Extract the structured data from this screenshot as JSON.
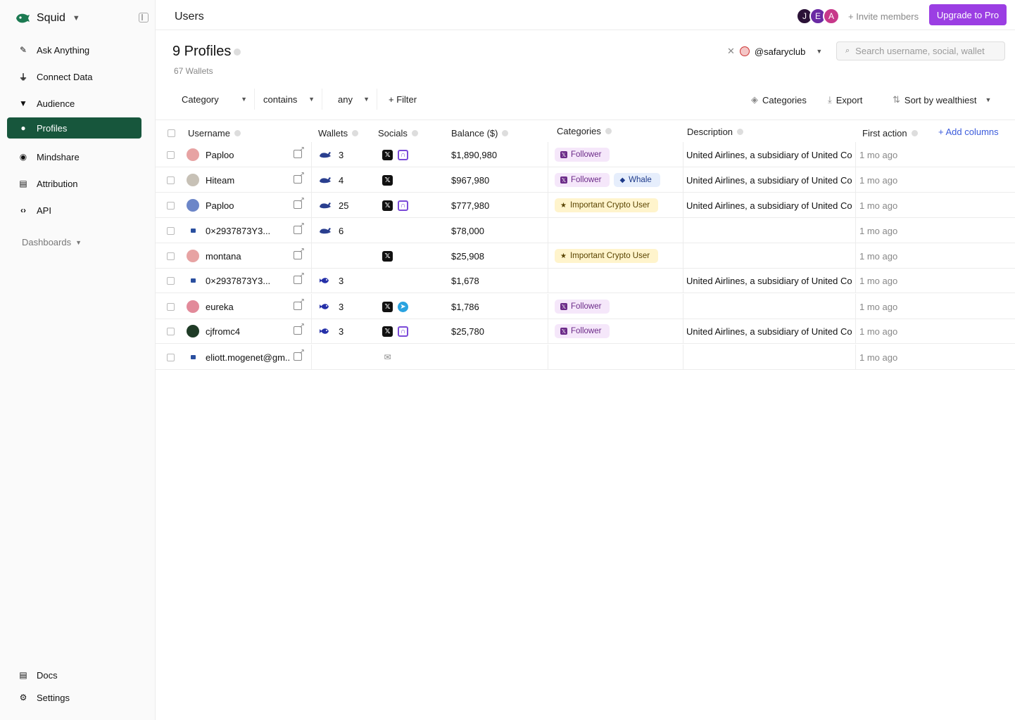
{
  "sidebar": {
    "brand": "Squid",
    "items": [
      {
        "label": "Ask Anything",
        "icon": "magic-wand-icon"
      },
      {
        "label": "Connect Data",
        "icon": "plug-icon"
      },
      {
        "label": "Audience",
        "icon": "funnel-icon"
      },
      {
        "label": "Profiles",
        "icon": "user-icon",
        "active": true
      },
      {
        "label": "Mindshare",
        "icon": "compass-icon"
      },
      {
        "label": "Attribution",
        "icon": "document-icon"
      },
      {
        "label": "API",
        "icon": "code-icon"
      }
    ],
    "section": "Dashboards",
    "footer": [
      {
        "label": "Docs",
        "icon": "book-icon"
      },
      {
        "label": "Settings",
        "icon": "gear-icon"
      }
    ]
  },
  "topbar": {
    "title": "Users",
    "avatars": [
      {
        "letter": "J",
        "color": "#2b1237"
      },
      {
        "letter": "E",
        "color": "#6a2aa3"
      },
      {
        "letter": "A",
        "color": "#c7388a"
      }
    ],
    "invite": "+ Invite members",
    "upgrade": "Upgrade to Pro"
  },
  "header": {
    "title": "9 Profiles",
    "subtitle": "67 Wallets",
    "account": "@safaryclub",
    "search_placeholder": "Search username, social, wallet"
  },
  "filters": {
    "category": "Category",
    "operator": "contains",
    "value": "any",
    "add": "+ Filter",
    "categories": "Categories",
    "export": "Export",
    "sort": "Sort by wealthiest"
  },
  "table": {
    "columns": {
      "username": "Username",
      "wallets": "Wallets",
      "socials": "Socials",
      "balance": "Balance ($)",
      "categories": "Categories",
      "description": "Description",
      "first_action": "First action",
      "add_columns": "+ Add columns"
    },
    "rows": [
      {
        "username": "Paploo",
        "avatar": "#e7a3a3",
        "wallet_icon": "whale",
        "wallets": "3",
        "socials": [
          "x",
          "farcaster"
        ],
        "balance": "$1,890,980",
        "tags": [
          {
            "label": "Follower",
            "type": "follower"
          }
        ],
        "description": "United Airlines, a subsidiary of United Co",
        "ago": "1 mo ago"
      },
      {
        "username": "Hiteam",
        "avatar": "#c7c1b6",
        "wallet_icon": "whale",
        "wallets": "4",
        "socials": [
          "x"
        ],
        "balance": "$967,980",
        "tags": [
          {
            "label": "Follower",
            "type": "follower"
          },
          {
            "label": "Whale",
            "type": "whale"
          }
        ],
        "description": "United Airlines, a subsidiary of United Co",
        "ago": "1 mo ago"
      },
      {
        "username": "Paploo",
        "avatar": "#6c86c8",
        "wallet_icon": "whale",
        "wallets": "25",
        "socials": [
          "x",
          "farcaster"
        ],
        "balance": "$777,980",
        "tags": [
          {
            "label": "Important Crypto User",
            "type": "important"
          }
        ],
        "description": "United Airlines, a subsidiary of United Co",
        "ago": "1 mo ago"
      },
      {
        "username": "0×2937873Y3...",
        "avatar": "wallet",
        "wallet_icon": "whale",
        "wallets": "6",
        "socials": [],
        "balance": "$78,000",
        "tags": [],
        "description": "",
        "ago": "1 mo ago"
      },
      {
        "username": "montana",
        "avatar": "#e7a3a3",
        "wallet_icon": "",
        "wallets": "",
        "socials": [
          "x"
        ],
        "balance": "$25,908",
        "tags": [
          {
            "label": "Important Crypto User",
            "type": "important"
          }
        ],
        "description": "",
        "ago": "1 mo ago"
      },
      {
        "username": "0×2937873Y3...",
        "avatar": "wallet",
        "wallet_icon": "fish",
        "wallets": "3",
        "socials": [],
        "balance": "$1,678",
        "tags": [],
        "description": "United Airlines, a subsidiary of United Co",
        "ago": "1 mo ago"
      },
      {
        "username": "eureka",
        "avatar": "#e28a9a",
        "wallet_icon": "fish",
        "wallets": "3",
        "socials": [
          "x",
          "telegram"
        ],
        "balance": "$1,786",
        "tags": [
          {
            "label": "Follower",
            "type": "follower"
          }
        ],
        "description": "",
        "ago": "1 mo ago"
      },
      {
        "username": "cjfromc4",
        "avatar": "#1f3b26",
        "wallet_icon": "fish",
        "wallets": "3",
        "socials": [
          "x",
          "farcaster"
        ],
        "balance": "$25,780",
        "tags": [
          {
            "label": "Follower",
            "type": "follower"
          }
        ],
        "description": "United Airlines, a subsidiary of United Co",
        "ago": "1 mo ago"
      },
      {
        "username": "eliott.mogenet@gm..",
        "avatar": "wallet",
        "wallet_icon": "",
        "wallets": "",
        "socials": [
          "mail"
        ],
        "balance": "",
        "tags": [],
        "description": "",
        "ago": "1 mo ago"
      }
    ]
  }
}
